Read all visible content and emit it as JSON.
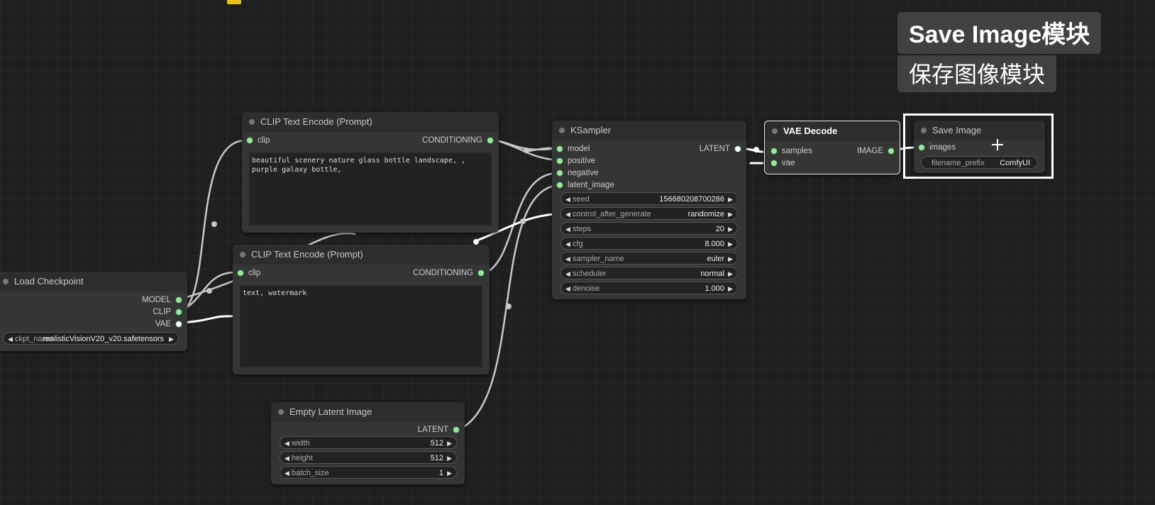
{
  "load_checkpoint": {
    "title": "Load Checkpoint",
    "outputs": [
      "MODEL",
      "CLIP",
      "VAE"
    ],
    "widget": {
      "name": "ckpt_name",
      "value": "realisticVisionV20_v20.safetensors"
    }
  },
  "clip_positive": {
    "title": "CLIP Text Encode (Prompt)",
    "input": "clip",
    "output": "CONDITIONING",
    "text": "beautiful scenery nature glass bottle landscape, , purple galaxy bottle,"
  },
  "clip_negative": {
    "title": "CLIP Text Encode (Prompt)",
    "input": "clip",
    "output": "CONDITIONING",
    "text": "text, watermark"
  },
  "ksampler": {
    "title": "KSampler",
    "inputs": [
      "model",
      "positive",
      "negative",
      "latent_image"
    ],
    "output": "LATENT",
    "widgets": [
      {
        "name": "seed",
        "value": "156680208700286"
      },
      {
        "name": "control_after_generate",
        "value": "randomize"
      },
      {
        "name": "steps",
        "value": "20"
      },
      {
        "name": "cfg",
        "value": "8.000"
      },
      {
        "name": "sampler_name",
        "value": "euler"
      },
      {
        "name": "scheduler",
        "value": "normal"
      },
      {
        "name": "denoise",
        "value": "1.000"
      }
    ]
  },
  "vae_decode": {
    "title": "VAE Decode",
    "inputs": [
      "samples",
      "vae"
    ],
    "output": "IMAGE"
  },
  "save_image": {
    "title": "Save Image",
    "input": "images",
    "widget": {
      "name": "filename_prefix",
      "value": "ComfyUI"
    }
  },
  "empty_latent": {
    "title": "Empty Latent Image",
    "output": "LATENT",
    "widgets": [
      {
        "name": "width",
        "value": "512"
      },
      {
        "name": "height",
        "value": "512"
      },
      {
        "name": "batch_size",
        "value": "1"
      }
    ]
  },
  "caption": {
    "line1": "Save Image模块",
    "line2": "保存图像模块"
  },
  "colors": {
    "background": "#1f1f1f",
    "node": "#353535",
    "slot_dot": "#9fe39f",
    "link": "#d0d0d0",
    "highlight": "#ffffff"
  }
}
